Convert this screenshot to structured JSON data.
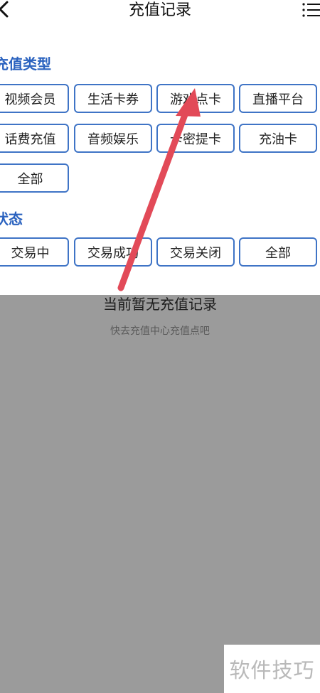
{
  "header": {
    "title": "充值记录"
  },
  "type_section": {
    "title": "充值类型",
    "chips": [
      "视频会员",
      "生活卡券",
      "游戏点卡",
      "直播平台",
      "话费充值",
      "音频娱乐",
      "卡密提卡",
      "充油卡",
      "全部"
    ]
  },
  "status_section": {
    "title": "状态",
    "chips": [
      "交易中",
      "交易成功",
      "交易关闭",
      "全部"
    ]
  },
  "empty_state": {
    "title": "当前暂无充值记录",
    "subtitle": "快去充值中心充值点吧"
  },
  "watermark": "软件技巧",
  "colors": {
    "accent": "#2a62bf",
    "arrow": "#e24a58",
    "overlay": "#9b9b9b"
  }
}
